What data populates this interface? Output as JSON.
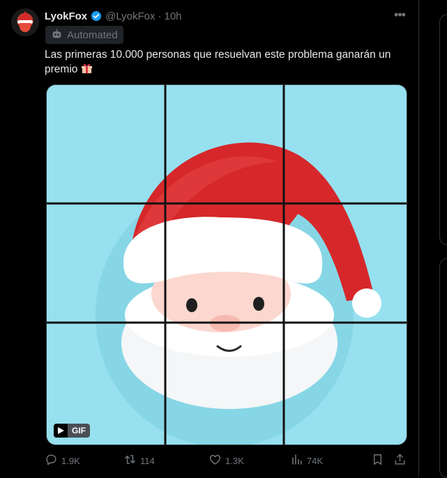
{
  "tweet": {
    "author_name": "LyokFox",
    "handle": "@LyokFox",
    "separator": "·",
    "time": "10h",
    "badge_label": "Automated",
    "text": "Las primeras 10.000 personas que resuelvan este problema ganarán un premio",
    "gif_label": "GIF",
    "actions": {
      "replies": "1.9K",
      "reposts": "114",
      "likes": "1.3K",
      "views": "74K"
    }
  },
  "icons": [
    "verified-badge-icon",
    "more-icon",
    "robot-icon",
    "gift-emoji-icon",
    "play-icon",
    "reply-icon",
    "repost-icon",
    "like-icon",
    "views-icon",
    "bookmark-icon",
    "share-icon"
  ],
  "colors": {
    "background": "#000000",
    "text": "#e7e9ea",
    "muted": "#71767b",
    "verified": "#1d9bf0",
    "media_background": "#96e0ef",
    "santa_hat": "#d6282a"
  }
}
